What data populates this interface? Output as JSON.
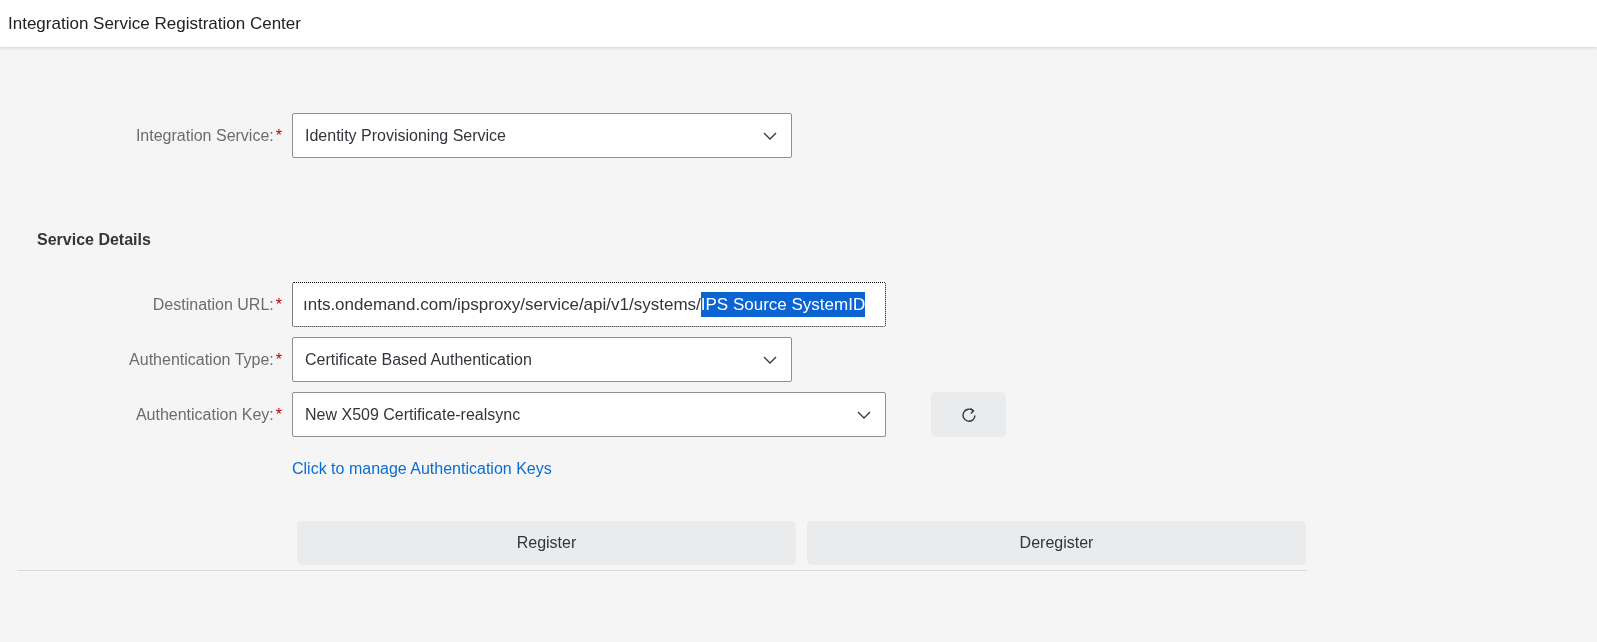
{
  "header": {
    "title": "Integration Service Registration Center"
  },
  "integration_service": {
    "label": "Integration Service:",
    "required_mark": "*",
    "value": "Identity Provisioning Service"
  },
  "section": {
    "title": "Service Details"
  },
  "fields": [
    {
      "kind": "text",
      "label": "Destination URL:",
      "required_mark": "*",
      "focused": true,
      "value": "ınts.ondemand.com/ipsproxy/service/api/v1/systems/",
      "selected_text": "IPS Source SystemID"
    },
    {
      "kind": "select",
      "label": "Authentication Type:",
      "required_mark": "*",
      "value": "Certificate Based Authentication"
    },
    {
      "kind": "select_refresh",
      "label": "Authentication Key:",
      "required_mark": "*",
      "value": "New X509 Certificate-realsync"
    }
  ],
  "link": "Click to manage Authentication Keys",
  "buttons": [
    "Register",
    "Deregister"
  ]
}
